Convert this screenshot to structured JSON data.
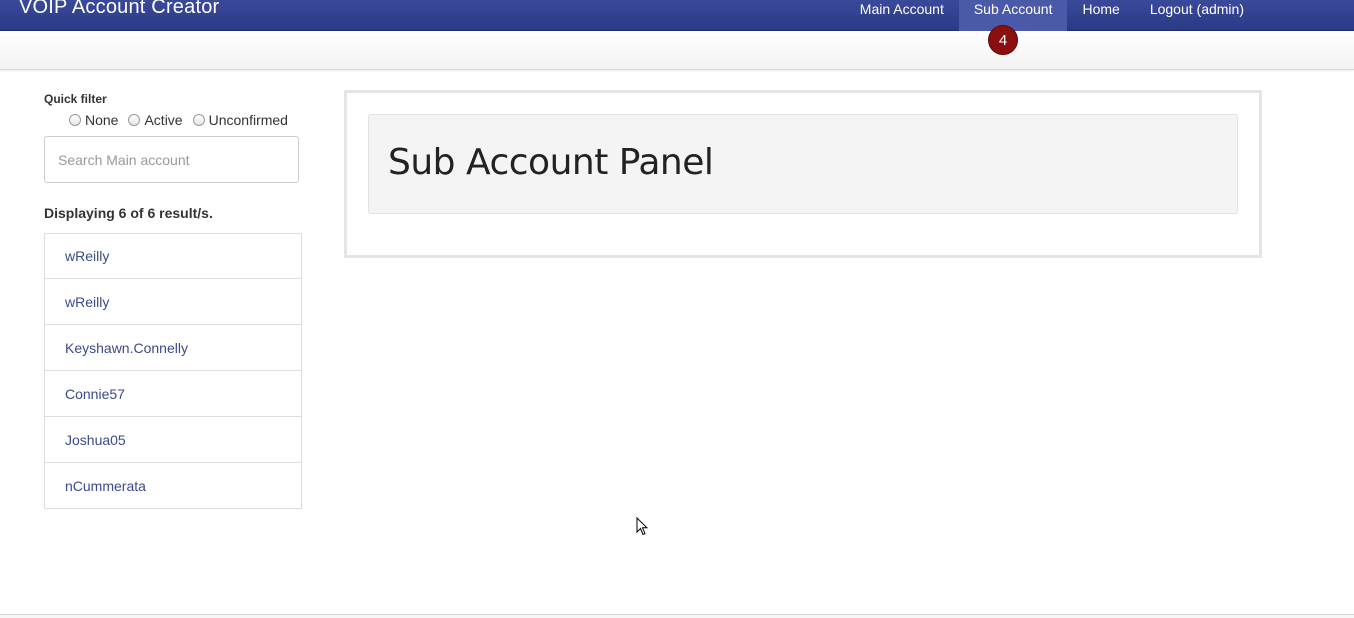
{
  "app": {
    "title": "VOIP Account Creator"
  },
  "nav": {
    "links": [
      {
        "label": "Main Account"
      },
      {
        "label": "Sub Account"
      },
      {
        "label": "Home"
      },
      {
        "label": "Logout (admin)"
      }
    ],
    "active": "Sub Account",
    "badge": "4"
  },
  "sidebar": {
    "quick_filter_label": "Quick filter",
    "filters": [
      {
        "label": "None"
      },
      {
        "label": "Active"
      },
      {
        "label": "Unconfirmed"
      }
    ],
    "search_placeholder": "Search Main account",
    "result_count": "Displaying 6 of 6 result/s.",
    "accounts": [
      {
        "name": "wReilly"
      },
      {
        "name": "wReilly"
      },
      {
        "name": "Keyshawn.Connelly"
      },
      {
        "name": "Connie57"
      },
      {
        "name": "Joshua05"
      },
      {
        "name": "nCummerata"
      }
    ]
  },
  "main": {
    "panel_title": "Sub Account Panel"
  },
  "colors": {
    "navbar": "#2b3a85",
    "badge": "#8b0f0f",
    "link": "#3a4a8a"
  }
}
